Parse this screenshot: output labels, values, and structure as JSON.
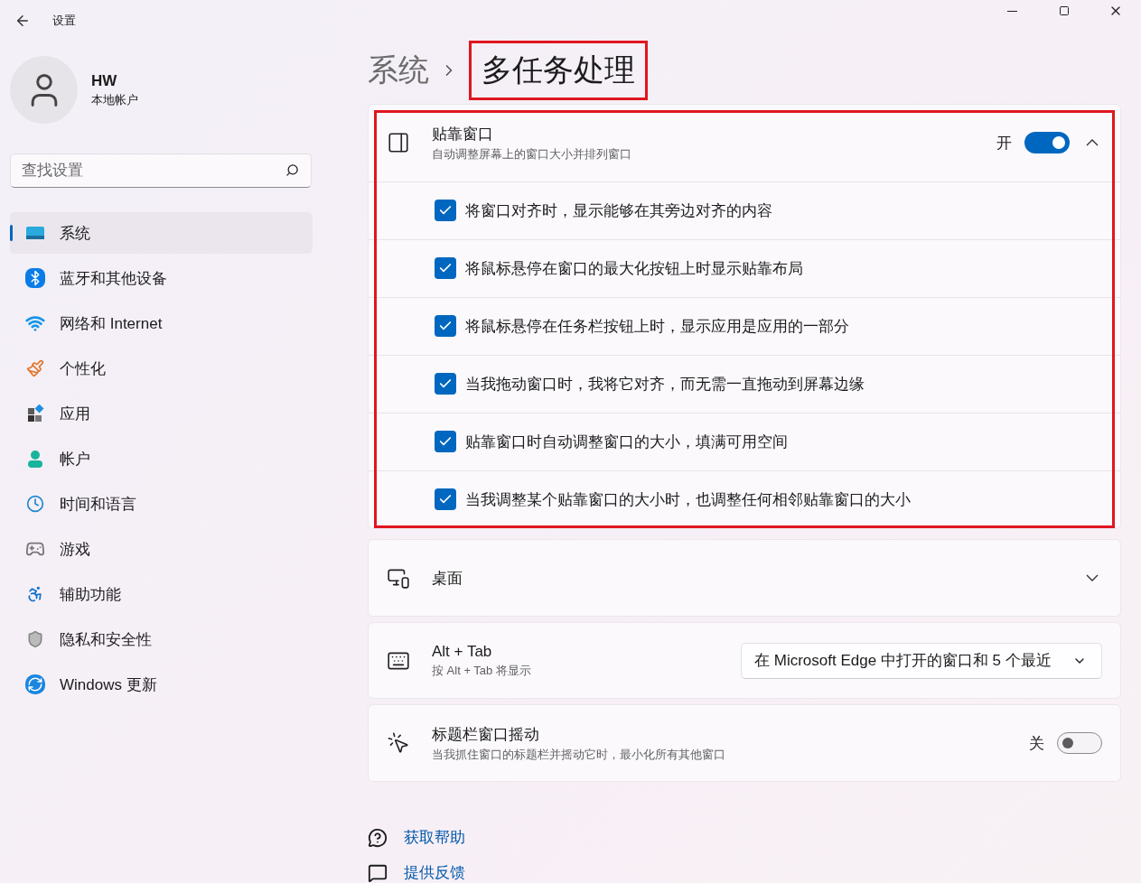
{
  "window": {
    "title": "设置"
  },
  "profile": {
    "name": "HW",
    "account_type": "本地帐户"
  },
  "search": {
    "placeholder": "查找设置"
  },
  "nav": [
    {
      "label": "系统",
      "selected": true
    },
    {
      "label": "蓝牙和其他设备",
      "selected": false
    },
    {
      "label": "网络和 Internet",
      "selected": false
    },
    {
      "label": "个性化",
      "selected": false
    },
    {
      "label": "应用",
      "selected": false
    },
    {
      "label": "帐户",
      "selected": false
    },
    {
      "label": "时间和语言",
      "selected": false
    },
    {
      "label": "游戏",
      "selected": false
    },
    {
      "label": "辅助功能",
      "selected": false
    },
    {
      "label": "隐私和安全性",
      "selected": false
    },
    {
      "label": "Windows 更新",
      "selected": false
    }
  ],
  "breadcrumb": {
    "parent": "系统",
    "current": "多任务处理",
    "highlighted": true
  },
  "snap": {
    "title": "贴靠窗口",
    "description": "自动调整屏幕上的窗口大小并排列窗口",
    "state_label": "开",
    "on": true,
    "expanded": true,
    "highlighted": true,
    "options": [
      {
        "label": "将窗口对齐时，显示能够在其旁边对齐的内容",
        "checked": true
      },
      {
        "label": "将鼠标悬停在窗口的最大化按钮上时显示贴靠布局",
        "checked": true
      },
      {
        "label": "将鼠标悬停在任务栏按钮上时，显示应用是应用的一部分",
        "checked": true
      },
      {
        "label": "当我拖动窗口时，我将它对齐，而无需一直拖动到屏幕边缘",
        "checked": true
      },
      {
        "label": "贴靠窗口时自动调整窗口的大小，填满可用空间",
        "checked": true
      },
      {
        "label": "当我调整某个贴靠窗口的大小时，也调整任何相邻贴靠窗口的大小",
        "checked": true
      }
    ]
  },
  "desktops": {
    "title": "桌面",
    "expanded": false
  },
  "alt_tab": {
    "title": "Alt + Tab",
    "description": "按 Alt + Tab 将显示",
    "value": "在 Microsoft Edge 中打开的窗口和 5 个最近"
  },
  "shake": {
    "title": "标题栏窗口摇动",
    "description": "当我抓住窗口的标题栏并摇动它时，最小化所有其他窗口",
    "state_label": "关",
    "on": false
  },
  "links": [
    {
      "label": "获取帮助"
    },
    {
      "label": "提供反馈"
    }
  ]
}
